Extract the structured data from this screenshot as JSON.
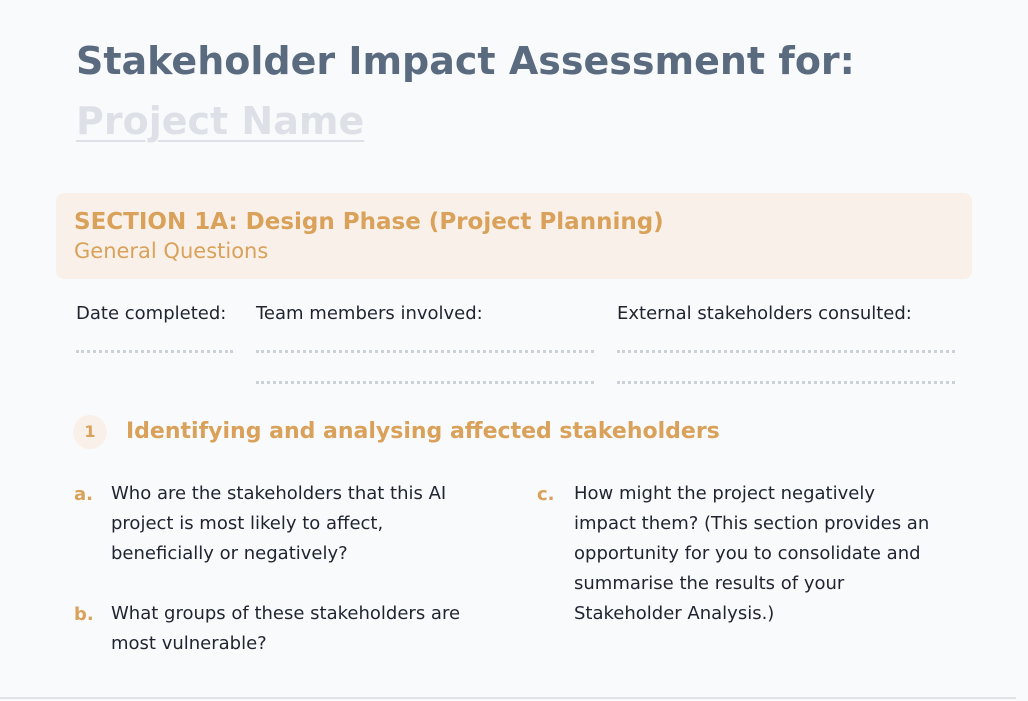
{
  "header": {
    "title": "Stakeholder Impact Assessment for:",
    "project_name": "Project Name"
  },
  "section": {
    "title": "SECTION 1A: Design Phase (Project Planning)",
    "subtitle": "General Questions"
  },
  "fields": {
    "date_label": "Date completed:",
    "team_label": "Team members involved:",
    "external_label": "External stakeholders consulted:"
  },
  "question": {
    "number": "1",
    "title": "Identifying and analysing affected stakeholders",
    "items": [
      {
        "letter": "a.",
        "text": "Who are the stakeholders that this AI project is most likely to affect, beneficially or negatively?"
      },
      {
        "letter": "b.",
        "text": "What groups of these stakeholders are most vulnerable?"
      },
      {
        "letter": "c.",
        "text": "How might the project negatively impact them? (This section provides an opportunity for you to consolidate and summarise the results of your Stakeholder Analysis.)"
      }
    ]
  },
  "colors": {
    "title": "#5a6b80",
    "accent": "#d9a15a",
    "section_bg": "#f9f1e9",
    "placeholder": "#dde1e7"
  }
}
